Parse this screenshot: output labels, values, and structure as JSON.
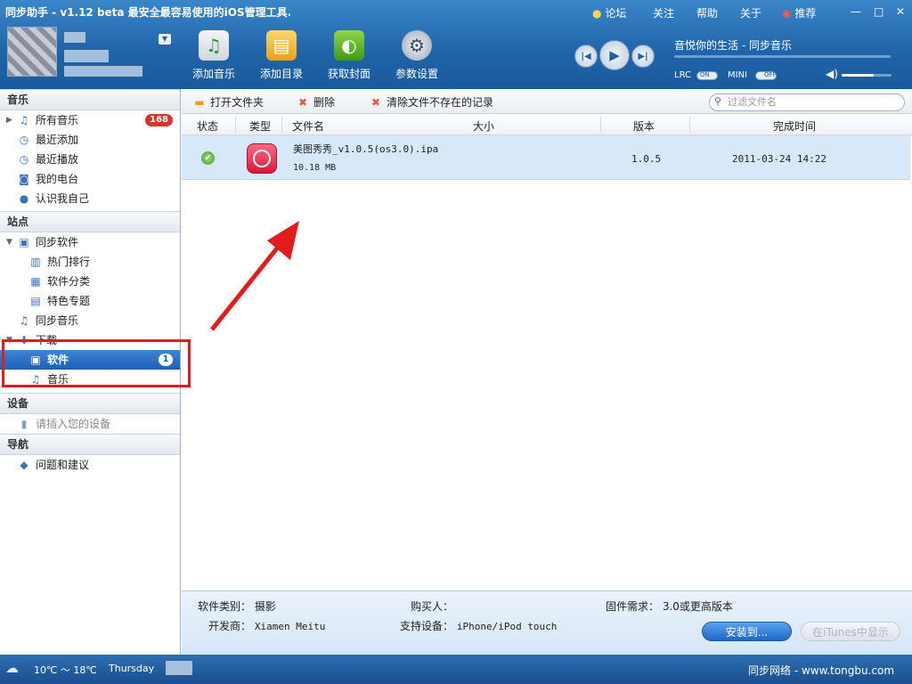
{
  "title": "同步助手 - v1.12 beta  最安全最容易使用的iOS管理工具.",
  "top_links": [
    "论坛",
    "关注",
    "帮助",
    "关于",
    "推荐"
  ],
  "window_controls": [
    "—",
    "□",
    "✕"
  ],
  "toolbar": [
    {
      "label": "添加音乐",
      "icon": "add-music-icon"
    },
    {
      "label": "添加目录",
      "icon": "add-folder-icon"
    },
    {
      "label": "获取封面",
      "icon": "get-cover-icon"
    },
    {
      "label": "参数设置",
      "icon": "settings-gear-icon"
    }
  ],
  "player": {
    "now_playing": "音悦你的生活 - 同步音乐",
    "lrc": "LRC",
    "lrc_state": "ON",
    "mini": "MINI",
    "mini_state": "OFF",
    "volume": 0.65
  },
  "sidebar": {
    "music_header": "音乐",
    "music_items": [
      {
        "label": "所有音乐",
        "badge": "168"
      },
      {
        "label": "最近添加"
      },
      {
        "label": "最近播放"
      },
      {
        "label": "我的电台"
      },
      {
        "label": "认识我自己"
      }
    ],
    "site_header": "站点",
    "sync_software": "同步软件",
    "sync_children": [
      "热门排行",
      "软件分类",
      "特色专题"
    ],
    "sync_music": "同步音乐",
    "download": "下载",
    "download_children": [
      {
        "label": "软件",
        "badge": "1"
      },
      {
        "label": "音乐"
      }
    ],
    "device_header": "设备",
    "device_item": "请插入您的设备",
    "nav_header": "导航",
    "nav_item": "问题和建议"
  },
  "file_toolbar": {
    "open_folder": "打开文件夹",
    "delete": "删除",
    "clear_missing": "清除文件不存在的记录",
    "search_placeholder": "过滤文件名"
  },
  "columns": [
    "状态",
    "类型",
    "文件名",
    "大小",
    "版本",
    "完成时间"
  ],
  "rows": [
    {
      "filename": "美图秀秀_v1.0.5(os3.0).ipa",
      "size": "10.18 MB",
      "version": "1.0.5",
      "completed": "2011-03-24 14:22"
    }
  ],
  "details": {
    "category_label": "软件类别：",
    "category": "摄影",
    "developer_label": "开发商：",
    "developer": "Xiamen Meitu",
    "buyer_label": "购买人：",
    "buyer": "",
    "device_label": "支持设备：",
    "device": "iPhone/iPod touch",
    "firmware_label": "固件需求：",
    "firmware": "3.0或更高版本",
    "install_button": "安装到...",
    "itunes_button": "在iTunes中显示"
  },
  "status": {
    "weather": "10℃ ～ 18℃",
    "day": "Thursday",
    "watermark": "同步网络 - www.tongbu.com"
  }
}
